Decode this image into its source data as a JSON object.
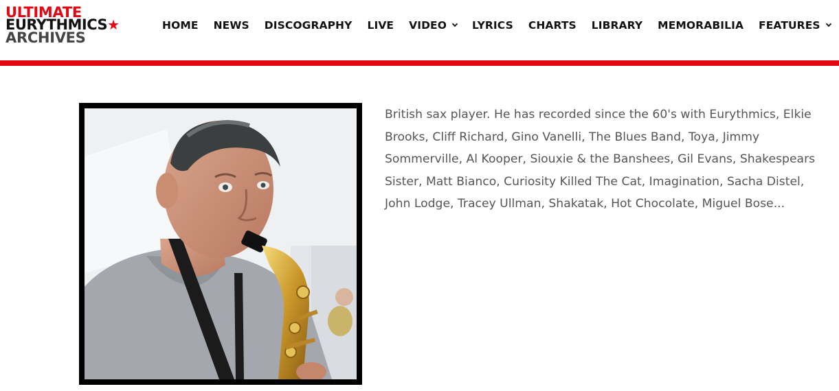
{
  "logo": {
    "line1": "ULTIMATE",
    "line2": "EURYTHMICS",
    "star": "★",
    "line3": "ARCHIVES"
  },
  "nav": {
    "items": [
      {
        "label": "HOME"
      },
      {
        "label": "NEWS"
      },
      {
        "label": "DISCOGRAPHY"
      },
      {
        "label": "LIVE"
      },
      {
        "label": "VIDEO",
        "dropdown": true
      },
      {
        "label": "LYRICS"
      },
      {
        "label": "CHARTS"
      },
      {
        "label": "LIBRARY"
      },
      {
        "label": "MEMORABILIA"
      },
      {
        "label": "FEATURES",
        "dropdown": true
      }
    ]
  },
  "colors": {
    "accent": "#e30613",
    "text": "#555555",
    "nav_text": "#111111"
  },
  "bio": {
    "text": "British sax player. He has recorded since the 60's with Eurythmics, Elkie Brooks, Cliff Richard, Gino Vanelli, The Blues Band, Toya, Jimmy Sommerville, Al Kooper, Siouxie & the Banshees, Gil Evans, Shakespears Sister, Matt Bianco, Curiosity Killed The Cat, Imagination, Sacha Distel, John Lodge, Tracey Ullman, Shakatak, Hot Chocolate, Miguel Bose..."
  }
}
